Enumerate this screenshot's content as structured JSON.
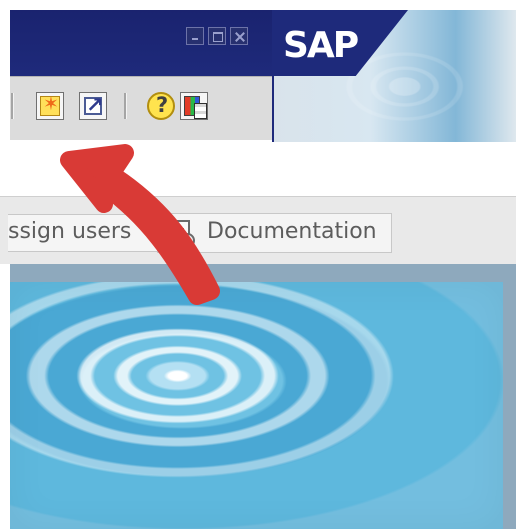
{
  "brand": {
    "logo_text": "SAP"
  },
  "toolbar": {
    "icons": [
      "create-session-icon",
      "shortcut-icon",
      "help-icon",
      "customize-layout-icon"
    ]
  },
  "actions": {
    "assign_users_label": "ssign users",
    "documentation_label": "Documentation"
  },
  "annotation": {
    "arrow_color": "#d93a36"
  },
  "colors": {
    "title_blue": "#1e2a7b",
    "toolbar_gray": "#dcdcdc",
    "water_blue": "#4aa8d4"
  }
}
